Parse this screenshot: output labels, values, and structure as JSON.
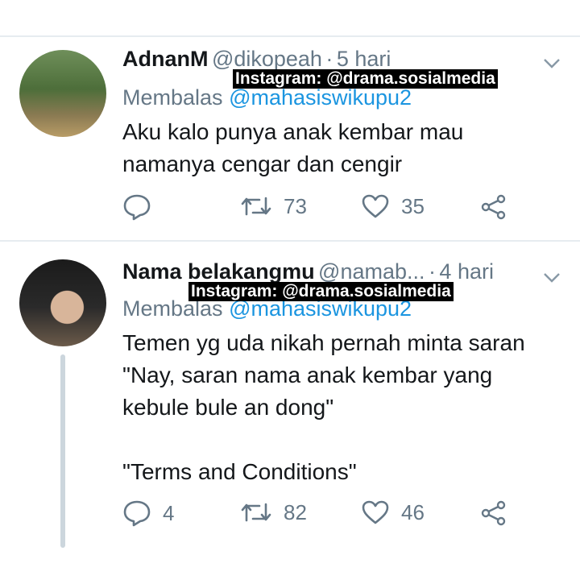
{
  "tweets": [
    {
      "name": "AdnanM",
      "handle": "@dikopeah",
      "separator": "·",
      "time": "5 hari",
      "reply_label": "Membalas",
      "reply_mention": "@mahasiswikupu2",
      "text": "Aku kalo punya anak kembar mau\nnamanya cengar dan cengir",
      "replies": "",
      "retweets": "73",
      "likes": "35"
    },
    {
      "name": "Nama belakangmu",
      "handle": "@namab...",
      "separator": "·",
      "time": "4 hari",
      "reply_label": "Membalas",
      "reply_mention": "@mahasiswikupu2",
      "text": "Temen yg uda nikah pernah minta saran\n\"Nay, saran nama anak kembar yang\nkebule bule an dong\"\n\n\"Terms and Conditions\"",
      "replies": "4",
      "retweets": "82",
      "likes": "46"
    }
  ],
  "watermark": "Instagram: @drama.sosialmedia",
  "icons": {
    "reply": "reply-icon",
    "retweet": "retweet-icon",
    "like": "heart-icon",
    "share": "share-icon",
    "menu": "chevron-down-icon"
  },
  "colors": {
    "link": "#1b95e0",
    "secondary_text": "#657786",
    "divider": "#e6ecf0",
    "thread_line": "#ccd6dd"
  }
}
